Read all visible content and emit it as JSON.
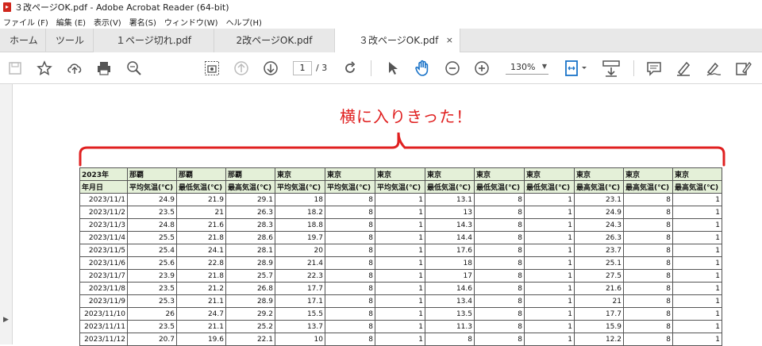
{
  "window": {
    "title": "３改ページOK.pdf - Adobe Acrobat Reader (64-bit)"
  },
  "menu": [
    "ファイル (F)",
    "編集 (E)",
    "表示(V)",
    "署名(S)",
    "ウィンドウ(W)",
    "ヘルプ(H)"
  ],
  "tabs": {
    "home": "ホーム",
    "tools": "ツール",
    "doc1": "１ページ切れ.pdf",
    "doc2": "2改ページOK.pdf",
    "doc3": "３改ページOK.pdf",
    "close": "×"
  },
  "toolbar": {
    "page_current": "1",
    "page_total": "/ 3",
    "zoom": "130%"
  },
  "annotation": "横に入りきった！",
  "table": {
    "header1": [
      "2023年",
      "那覇",
      "那覇",
      "那覇",
      "東京",
      "東京",
      "東京",
      "東京",
      "東京",
      "東京",
      "東京",
      "東京",
      "東京"
    ],
    "header2": [
      "年月日",
      "平均気温(℃)",
      "最低気温(℃)",
      "最高気温(℃)",
      "平均気温(℃)",
      "平均気温(℃)",
      "平均気温(℃)",
      "最低気温(℃)",
      "最低気温(℃)",
      "最低気温(℃)",
      "最高気温(℃)",
      "最高気温(℃)",
      "最高気温(℃)"
    ],
    "rows": [
      [
        "2023/11/1",
        "24.9",
        "21.9",
        "29.1",
        "18",
        "8",
        "1",
        "13.1",
        "8",
        "1",
        "23.1",
        "8",
        "1"
      ],
      [
        "2023/11/2",
        "23.5",
        "21",
        "26.3",
        "18.2",
        "8",
        "1",
        "13",
        "8",
        "1",
        "24.9",
        "8",
        "1"
      ],
      [
        "2023/11/3",
        "24.8",
        "21.6",
        "28.3",
        "18.8",
        "8",
        "1",
        "14.3",
        "8",
        "1",
        "24.3",
        "8",
        "1"
      ],
      [
        "2023/11/4",
        "25.5",
        "21.8",
        "28.6",
        "19.7",
        "8",
        "1",
        "14.4",
        "8",
        "1",
        "26.3",
        "8",
        "1"
      ],
      [
        "2023/11/5",
        "25.4",
        "24.1",
        "28.1",
        "20",
        "8",
        "1",
        "17.6",
        "8",
        "1",
        "23.7",
        "8",
        "1"
      ],
      [
        "2023/11/6",
        "25.6",
        "22.8",
        "28.9",
        "21.4",
        "8",
        "1",
        "18",
        "8",
        "1",
        "25.1",
        "8",
        "1"
      ],
      [
        "2023/11/7",
        "23.9",
        "21.8",
        "25.7",
        "22.3",
        "8",
        "1",
        "17",
        "8",
        "1",
        "27.5",
        "8",
        "1"
      ],
      [
        "2023/11/8",
        "23.5",
        "21.2",
        "26.8",
        "17.7",
        "8",
        "1",
        "14.6",
        "8",
        "1",
        "21.6",
        "8",
        "1"
      ],
      [
        "2023/11/9",
        "25.3",
        "21.1",
        "28.9",
        "17.1",
        "8",
        "1",
        "13.4",
        "8",
        "1",
        "21",
        "8",
        "1"
      ],
      [
        "2023/11/10",
        "26",
        "24.7",
        "29.2",
        "15.5",
        "8",
        "1",
        "13.5",
        "8",
        "1",
        "17.7",
        "8",
        "1"
      ],
      [
        "2023/11/11",
        "23.5",
        "21.1",
        "25.2",
        "13.7",
        "8",
        "1",
        "11.3",
        "8",
        "1",
        "15.9",
        "8",
        "1"
      ],
      [
        "2023/11/12",
        "20.7",
        "19.6",
        "22.1",
        "10",
        "8",
        "1",
        "8",
        "8",
        "1",
        "12.2",
        "8",
        "1"
      ]
    ]
  }
}
